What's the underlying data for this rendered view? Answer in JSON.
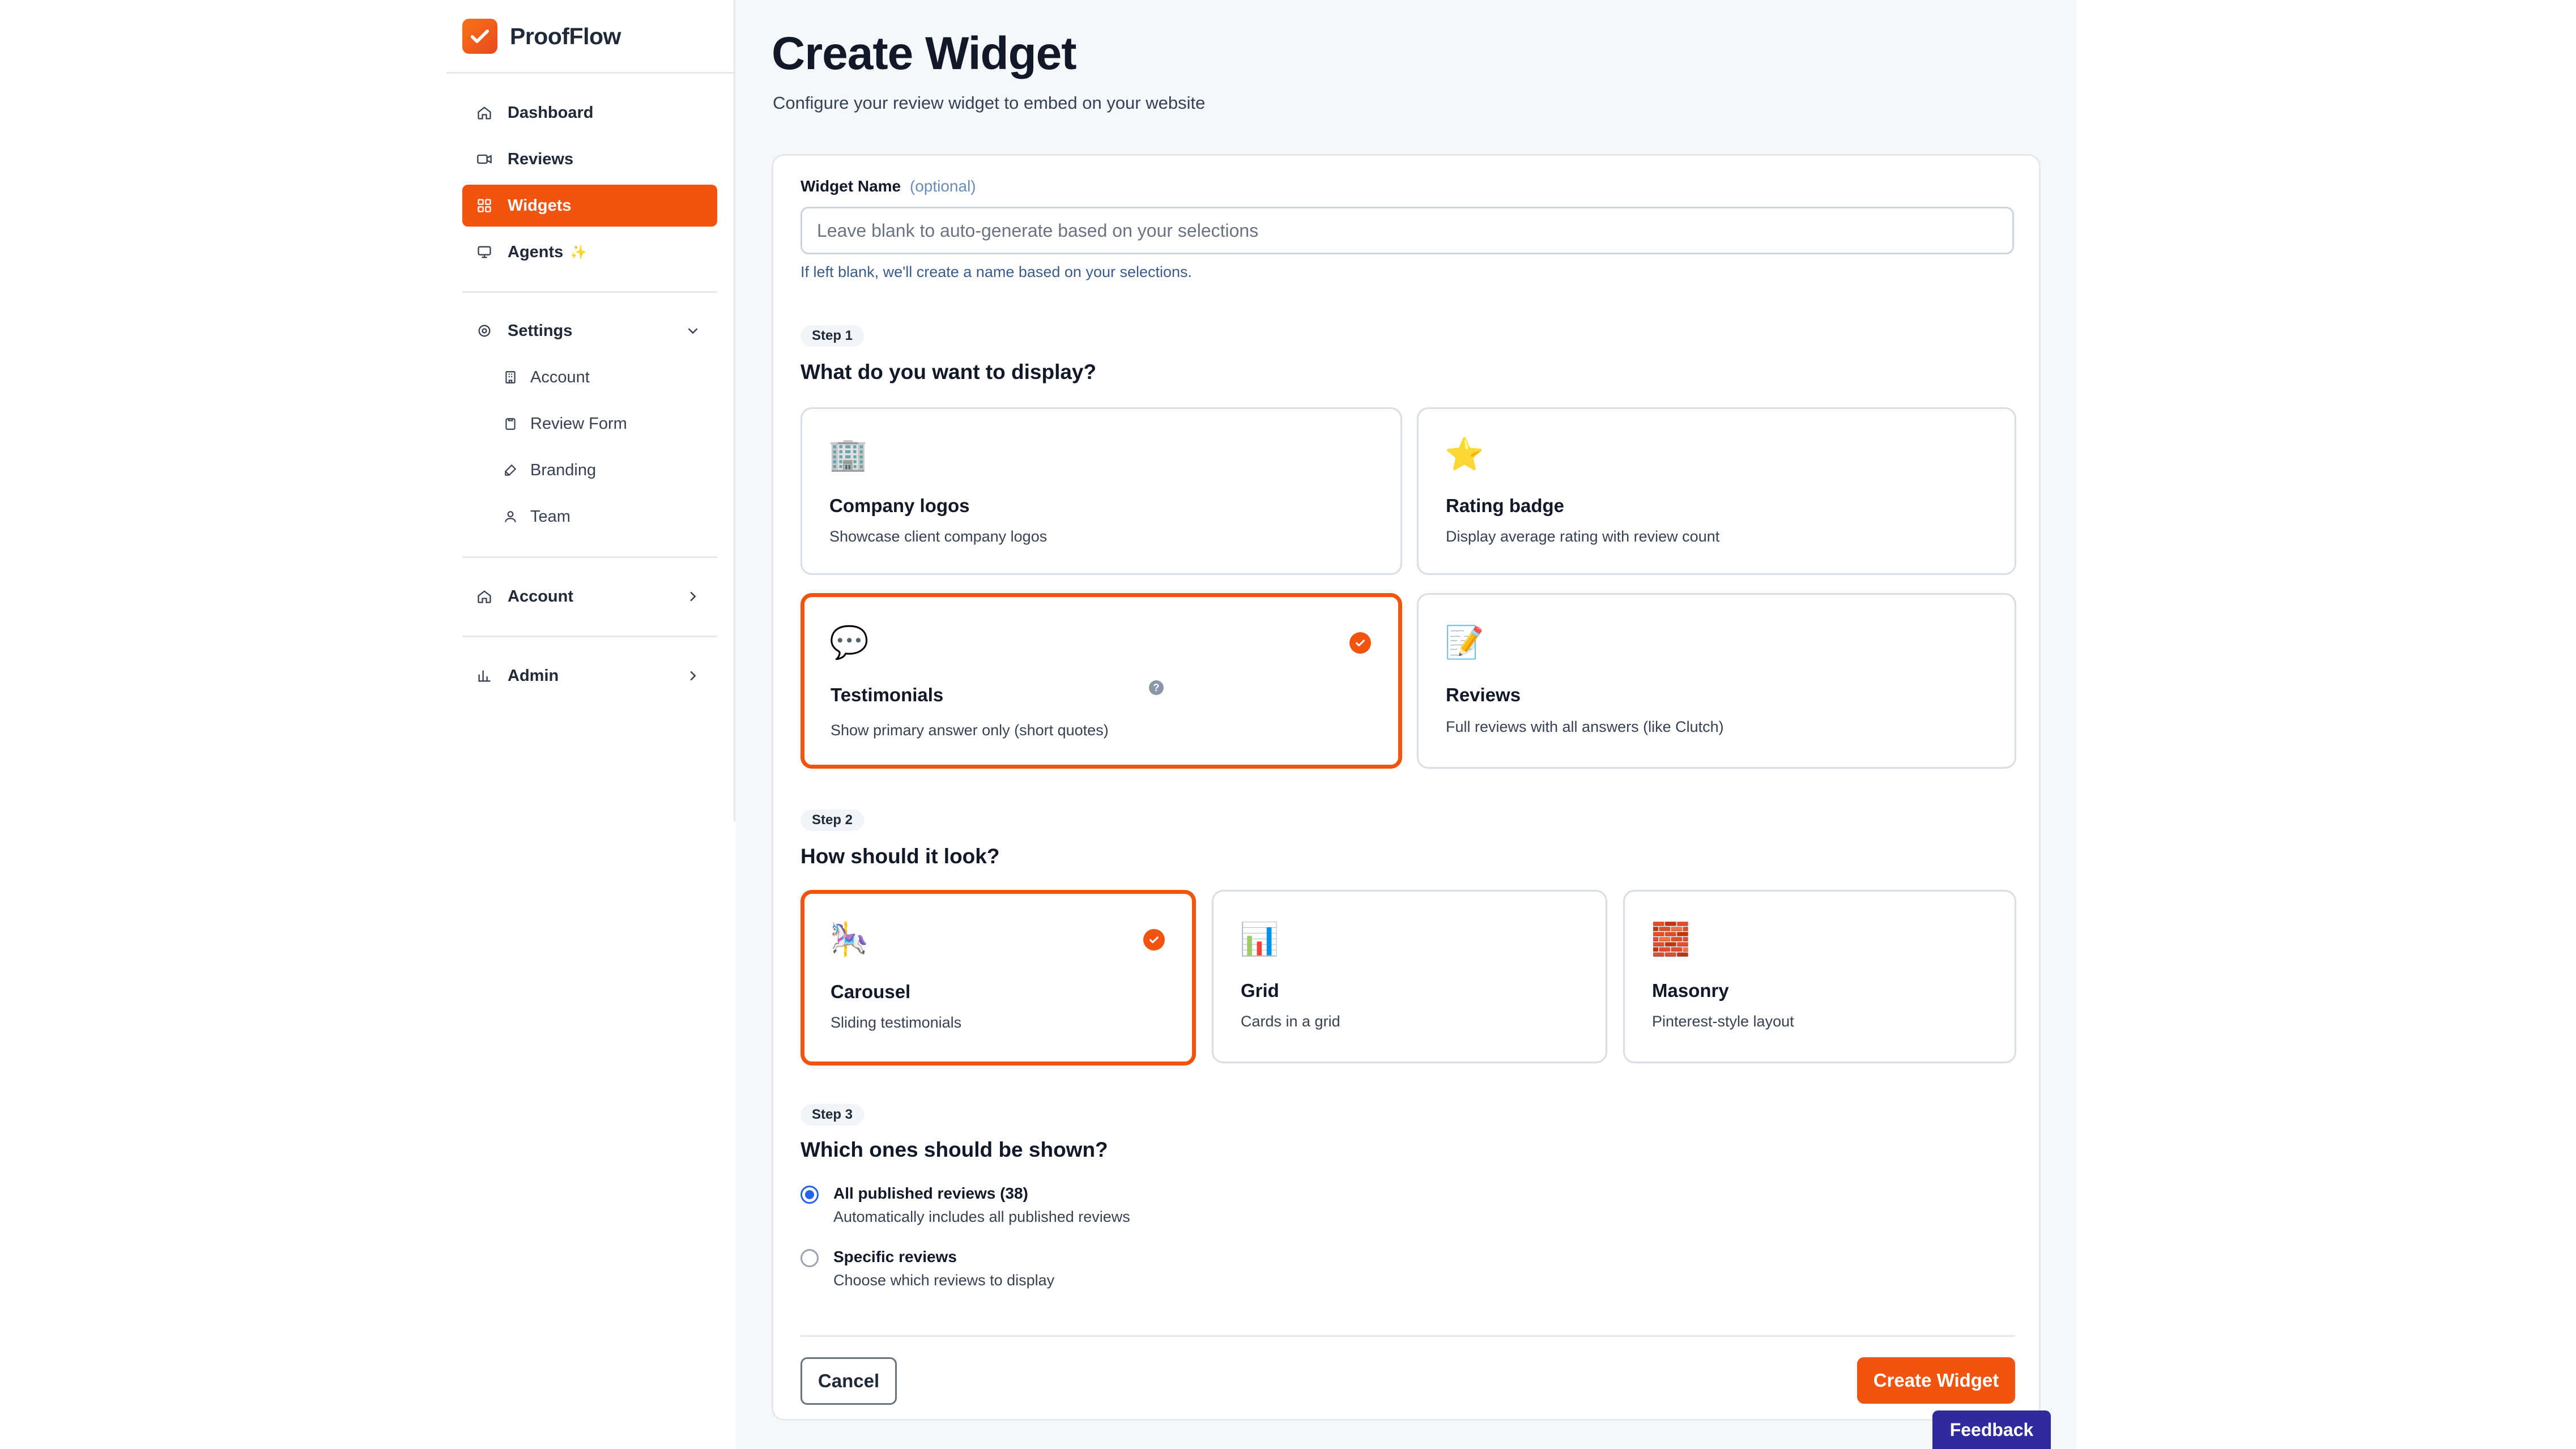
{
  "app": {
    "name": "ProofFlow"
  },
  "sidebar": {
    "nav": [
      {
        "label": "Dashboard",
        "icon": "home-icon"
      },
      {
        "label": "Reviews",
        "icon": "video-icon"
      },
      {
        "label": "Widgets",
        "icon": "widgets-icon",
        "active": true
      },
      {
        "label": "Agents",
        "icon": "monitor-icon",
        "sparkle": "✨"
      }
    ],
    "settings": {
      "label": "Settings",
      "items": [
        {
          "label": "Account"
        },
        {
          "label": "Review Form"
        },
        {
          "label": "Branding"
        },
        {
          "label": "Team"
        }
      ]
    },
    "account": {
      "label": "Account"
    },
    "admin": {
      "label": "Admin"
    }
  },
  "header": {
    "title": "Create Widget",
    "subtitle": "Configure your review widget to embed on your website"
  },
  "form": {
    "name_label": "Widget Name",
    "name_optional": "(optional)",
    "name_placeholder": "Leave blank to auto-generate based on your selections",
    "name_value": "",
    "name_hint": "If left blank, we'll create a name based on your selections."
  },
  "step1": {
    "badge": "Step 1",
    "question": "What do you want to display?",
    "options": [
      {
        "emoji": "🏢",
        "title": "Company logos",
        "desc": "Showcase client company logos",
        "selected": false
      },
      {
        "emoji": "⭐",
        "title": "Rating badge",
        "desc": "Display average rating with review count",
        "selected": false
      },
      {
        "emoji": "💬",
        "title": "Testimonials",
        "desc": "Show primary answer only (short quotes)",
        "selected": true,
        "help": "?"
      },
      {
        "emoji": "📝",
        "title": "Reviews",
        "desc": "Full reviews with all answers (like Clutch)",
        "selected": false
      }
    ]
  },
  "step2": {
    "badge": "Step 2",
    "question": "How should it look?",
    "options": [
      {
        "emoji": "🎠",
        "title": "Carousel",
        "desc": "Sliding testimonials",
        "selected": true
      },
      {
        "emoji": "📊",
        "title": "Grid",
        "desc": "Cards in a grid",
        "selected": false
      },
      {
        "emoji": "🧱",
        "title": "Masonry",
        "desc": "Pinterest-style layout",
        "selected": false
      }
    ]
  },
  "step3": {
    "badge": "Step 3",
    "question": "Which ones should be shown?",
    "options": [
      {
        "title": "All published reviews (38)",
        "desc": "Automatically includes all published reviews",
        "selected": true
      },
      {
        "title": "Specific reviews",
        "desc": "Choose which reviews to display",
        "selected": false
      }
    ]
  },
  "actions": {
    "cancel": "Cancel",
    "create": "Create Widget"
  },
  "feedback": {
    "label": "Feedback"
  },
  "colors": {
    "accent": "#f25410",
    "radio": "#2563eb",
    "feedback": "#2f2a9e"
  }
}
